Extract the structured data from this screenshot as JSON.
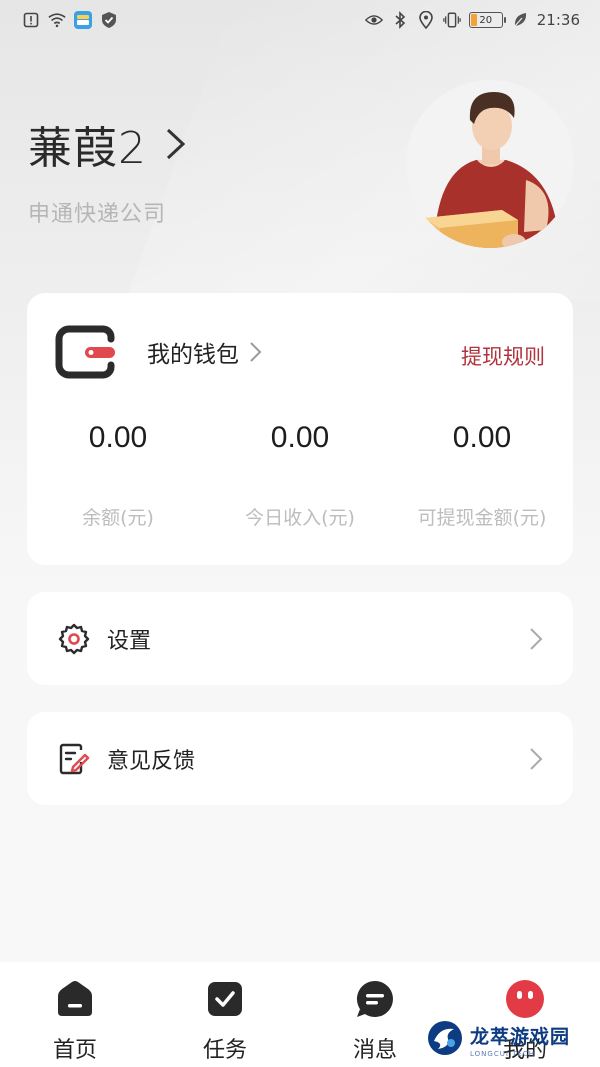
{
  "status_bar": {
    "battery_level": "20",
    "battery_fraction": 0.2,
    "time": "21:36",
    "left_icons": [
      "alert-icon",
      "wifi-icon",
      "wallet-app-icon",
      "shield-icon"
    ],
    "right_icons": [
      "eye-icon",
      "bluetooth-icon",
      "location-icon",
      "vibrate-icon",
      "battery-icon",
      "leaf-icon"
    ]
  },
  "profile": {
    "name": "蒹葭2",
    "company": "申通快递公司",
    "avatar_icon": "courier-avatar"
  },
  "wallet": {
    "title": "我的钱包",
    "rules_link": "提现规则",
    "icon": "wallet-icon",
    "stats": [
      {
        "value": "0.00",
        "label": "余额(元)"
      },
      {
        "value": "0.00",
        "label": "今日收入(元)"
      },
      {
        "value": "0.00",
        "label": "可提现金额(元)"
      }
    ]
  },
  "menu": {
    "settings": {
      "label": "设置",
      "icon": "gear-icon"
    },
    "feedback": {
      "label": "意见反馈",
      "icon": "feedback-icon"
    }
  },
  "tabbar": {
    "tabs": [
      {
        "label": "首页",
        "icon": "home-icon"
      },
      {
        "label": "任务",
        "icon": "task-icon"
      },
      {
        "label": "消息",
        "icon": "message-icon"
      },
      {
        "label": "我的",
        "icon": "mine-icon"
      }
    ]
  },
  "watermark": {
    "title": "龙萃游戏园",
    "subtitle": "LONGCUI TECH"
  },
  "colors": {
    "accent": "#b0343d",
    "active_tab": "#e23b45",
    "icon_dark": "#2a2a2a"
  }
}
